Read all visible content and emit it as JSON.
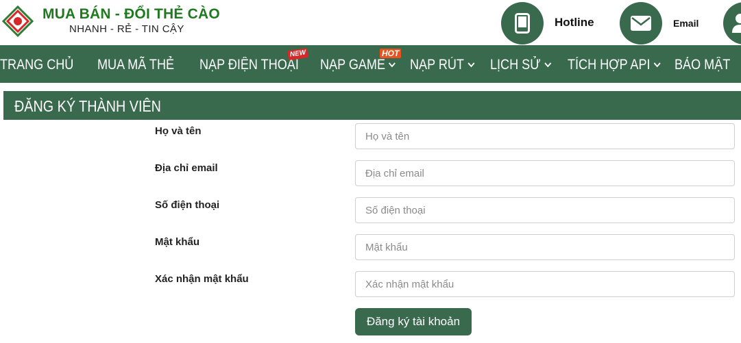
{
  "brand": {
    "title": "MUA BÁN - ĐỔI THẺ CÀO",
    "tagline": "NHANH - RẺ - TIN CẬY",
    "colors": {
      "primary": "#3a6a4e",
      "logo_green": "#1f7a1f",
      "logo_red": "#d62828"
    }
  },
  "contacts": {
    "hotline_label": "Hotline",
    "email_label": "Email",
    "icons": [
      "phone-icon",
      "mail-icon",
      "user-icon"
    ]
  },
  "nav": {
    "items": [
      {
        "label": "TRANG CHỦ",
        "has_dropdown": false
      },
      {
        "label": "MUA MÃ THẺ",
        "has_dropdown": false
      },
      {
        "label": "NẠP ĐIỆN THOẠI",
        "has_dropdown": false,
        "badge": "NEW"
      },
      {
        "label": "NẠP GAME",
        "has_dropdown": true,
        "badge": "HOT"
      },
      {
        "label": "NẠP RÚT",
        "has_dropdown": true
      },
      {
        "label": "LỊCH SỬ",
        "has_dropdown": true
      },
      {
        "label": "TÍCH HỢP API",
        "has_dropdown": true
      },
      {
        "label": "BẢO MẬT",
        "has_dropdown": false
      }
    ]
  },
  "section": {
    "title": "ĐĂNG KÝ THÀNH VIÊN"
  },
  "form": {
    "fields": [
      {
        "label": "Họ và tên",
        "placeholder": "Họ và tên",
        "value": ""
      },
      {
        "label": "Địa chỉ email",
        "placeholder": "Địa chỉ email",
        "value": ""
      },
      {
        "label": "Số điện thoại",
        "placeholder": "Số điện thoại",
        "value": ""
      },
      {
        "label": "Mật khẩu",
        "placeholder": "Mật khẩu",
        "value": ""
      },
      {
        "label": "Xác nhận mật khẩu",
        "placeholder": "Xác nhận mật khẩu",
        "value": ""
      }
    ],
    "submit_label": "Đăng ký tài khoản"
  }
}
